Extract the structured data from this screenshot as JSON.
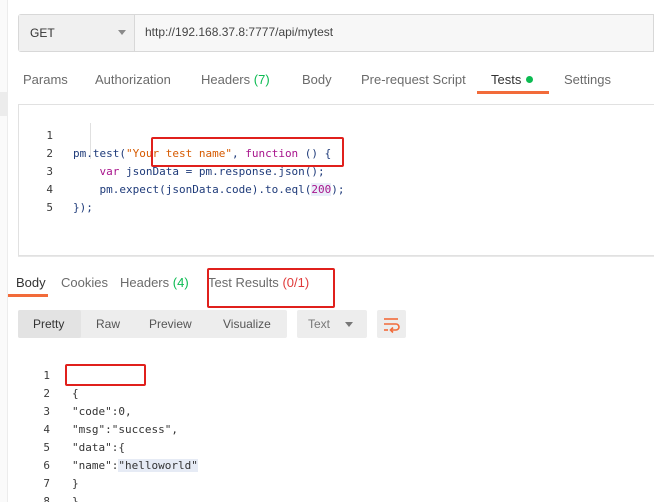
{
  "request": {
    "method": "GET",
    "url": "http://192.168.37.8:7777/api/mytest"
  },
  "request_tabs": [
    {
      "label": "Params"
    },
    {
      "label": "Authorization"
    },
    {
      "label": "Headers",
      "count": "(7)"
    },
    {
      "label": "Body"
    },
    {
      "label": "Pre-request Script"
    },
    {
      "label": "Tests",
      "active": true
    },
    {
      "label": "Settings"
    }
  ],
  "tests_script": {
    "line_numbers": [
      "1",
      "2",
      "3",
      "4",
      "5"
    ],
    "lines": [
      [
        "pm.test(",
        "\"Your test name\"",
        ", ",
        "function",
        " () {"
      ],
      [
        "    ",
        "var",
        " jsonData = pm.response.json();"
      ],
      [
        "    pm.expect(jsonData.code).to.eql(",
        "200",
        ");"
      ],
      [
        "});"
      ],
      [
        ""
      ]
    ]
  },
  "response_tabs": [
    {
      "label": "Body",
      "active": true
    },
    {
      "label": "Cookies"
    },
    {
      "label": "Headers",
      "count": "(4)"
    },
    {
      "label": "Test Results",
      "count": "(0/1)"
    }
  ],
  "response_view": {
    "modes": [
      "Pretty",
      "Raw",
      "Preview",
      "Visualize"
    ],
    "format": "Text"
  },
  "response_body": {
    "line_numbers": [
      "1",
      "2",
      "3",
      "4",
      "5",
      "6",
      "7",
      "8"
    ],
    "lines": [
      "{",
      "\"code\":0,",
      "\"msg\":\"success\",",
      "\"data\":{",
      [
        "\"name\":",
        "\"helloworld\""
      ],
      "}",
      "}",
      ""
    ]
  },
  "colors": {
    "accent": "#f26b3a",
    "success": "#0cbb52",
    "fail": "#e03a3a",
    "annotation": "#e0201c"
  },
  "icons": [
    "chevron-down-icon",
    "status-dot-icon",
    "wrap-lines-icon"
  ]
}
